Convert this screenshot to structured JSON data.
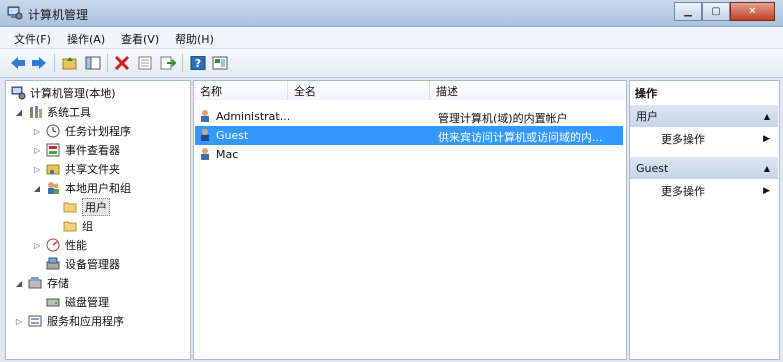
{
  "window": {
    "title": "计算机管理",
    "controls": {
      "minimize": "▁",
      "maximize": "▢",
      "close": "✕"
    }
  },
  "menu": {
    "items": [
      "文件(F)",
      "操作(A)",
      "查看(V)",
      "帮助(H)"
    ]
  },
  "toolbar": {
    "icons": [
      "back-arrow-icon",
      "forward-arrow-icon",
      "up-folder-icon",
      "show-hide-tree-icon",
      "delete-icon",
      "properties-icon",
      "export-icon",
      "help-icon",
      "view-icon"
    ]
  },
  "tree": {
    "root": "计算机管理(本地)",
    "system_tools": "系统工具",
    "task_scheduler": "任务计划程序",
    "event_viewer": "事件查看器",
    "shared_folders": "共享文件夹",
    "local_users_groups": "本地用户和组",
    "users": "用户",
    "groups": "组",
    "performance": "性能",
    "device_manager": "设备管理器",
    "storage": "存储",
    "disk_management": "磁盘管理",
    "services_apps": "服务和应用程序"
  },
  "list": {
    "columns": [
      "名称",
      "全名",
      "描述"
    ],
    "rows": [
      {
        "name": "Administrat...",
        "full_name": "",
        "description": "管理计算机(域)的内置帐户"
      },
      {
        "name": "Guest",
        "full_name": "",
        "description": "供来宾访问计算机或访问域的内..."
      },
      {
        "name": "Mac",
        "full_name": "",
        "description": ""
      }
    ],
    "selected_row": 1
  },
  "actions": {
    "header": "操作",
    "group1": {
      "title": "用户",
      "item": "更多操作"
    },
    "group2": {
      "title": "Guest",
      "item": "更多操作"
    }
  },
  "colors": {
    "selection": "#3399ff",
    "accent": "#2a6fb8"
  }
}
